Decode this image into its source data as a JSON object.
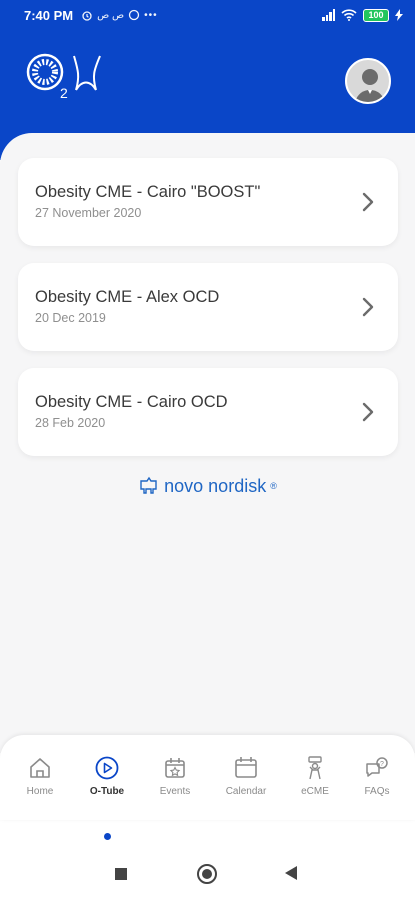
{
  "status_bar": {
    "time": "7:40 PM",
    "notifications": "ص ص",
    "battery": "100"
  },
  "sessions": [
    {
      "title": "Obesity CME - Cairo \"BOOST\"",
      "date": "27 November 2020"
    },
    {
      "title": "Obesity CME - Alex OCD",
      "date": "20 Dec 2019"
    },
    {
      "title": "Obesity CME - Cairo OCD",
      "date": "28 Feb 2020"
    }
  ],
  "sponsor": {
    "name": "novo nordisk",
    "mark": "®"
  },
  "bottom_nav": [
    {
      "label": "Home",
      "icon": "home-icon"
    },
    {
      "label": "O-Tube",
      "icon": "play-circle-icon",
      "active": true
    },
    {
      "label": "Events",
      "icon": "star-calendar-icon"
    },
    {
      "label": "Calendar",
      "icon": "calendar-icon"
    },
    {
      "label": "eCME",
      "icon": "ecme-icon"
    },
    {
      "label": "FAQs",
      "icon": "faq-chat-icon"
    }
  ],
  "colors": {
    "primary": "#0a46c8",
    "background": "#f6f6f7",
    "card": "#ffffff",
    "text": "#3a3a3a",
    "muted": "#8f8f8f"
  }
}
